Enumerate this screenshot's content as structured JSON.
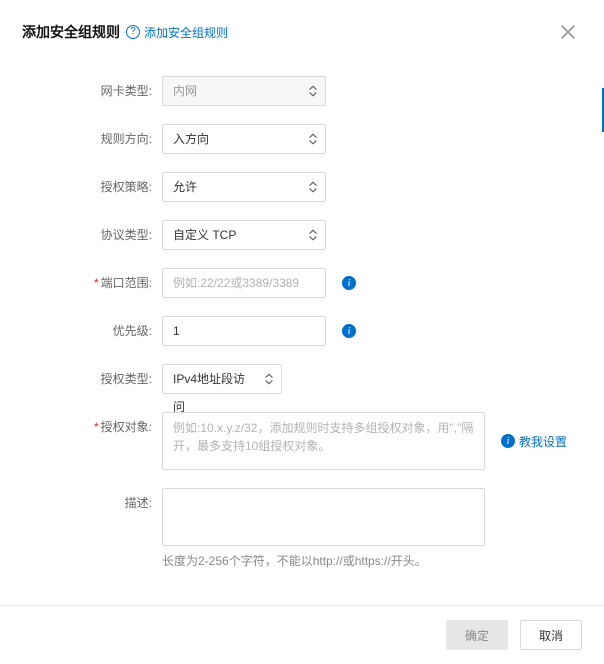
{
  "header": {
    "title": "添加安全组规则",
    "help_link_text": "添加安全组规则",
    "help_icon": "?"
  },
  "form": {
    "nic_type": {
      "label": "网卡类型:",
      "value": "内网"
    },
    "direction": {
      "label": "规则方向:",
      "value": "入方向"
    },
    "policy": {
      "label": "授权策略:",
      "value": "允许"
    },
    "protocol": {
      "label": "协议类型:",
      "value": "自定义 TCP"
    },
    "port_range": {
      "label": "端口范围:",
      "placeholder": "例如:22/22或3389/3389",
      "value": ""
    },
    "priority": {
      "label": "优先级:",
      "value": "1"
    },
    "auth_type": {
      "label": "授权类型:",
      "value": "IPv4地址段访问"
    },
    "auth_object": {
      "label": "授权对象:",
      "placeholder": "例如:10.x.y.z/32，添加规则时支持多组授权对象，用\",\"隔开，最多支持10组授权对象。",
      "value": ""
    },
    "description": {
      "label": "描述:",
      "placeholder": "",
      "value": "",
      "hint": "长度为2-256个字符，不能以http://或https://开头。"
    },
    "teach_link": "教我设置"
  },
  "footer": {
    "ok": "确定",
    "cancel": "取消"
  },
  "icons": {
    "close": "close-icon",
    "help": "help-icon",
    "info": "info-icon",
    "caret": "chevron-updown-icon"
  }
}
